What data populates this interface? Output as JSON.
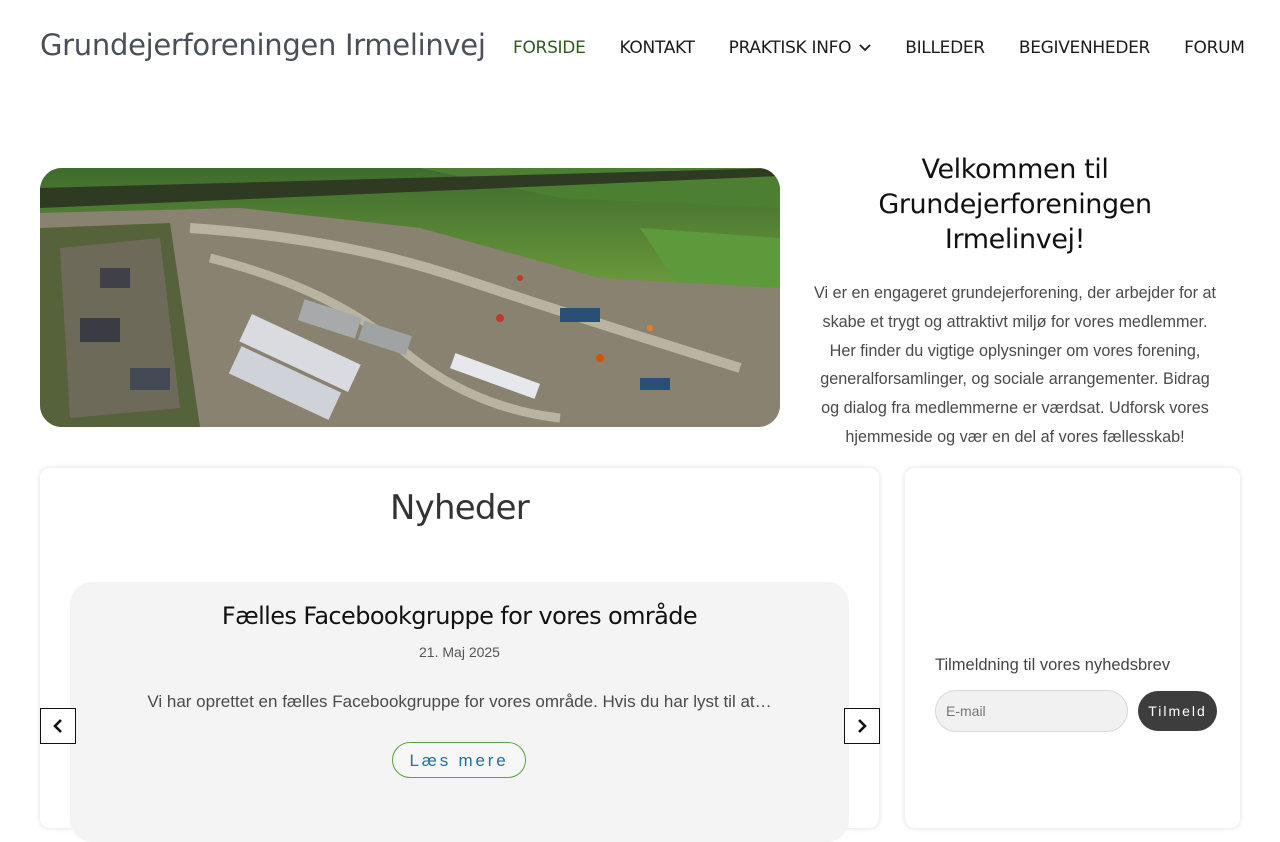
{
  "header": {
    "site_title": "Grundejerforeningen Irmelinvej",
    "nav": [
      {
        "label": "FORSIDE",
        "active": true
      },
      {
        "label": "KONTAKT"
      },
      {
        "label": "PRAKTISK INFO",
        "has_dropdown": true
      },
      {
        "label": "BILLEDER"
      },
      {
        "label": "BEGIVENHEDER"
      },
      {
        "label": "FORUM"
      }
    ]
  },
  "hero": {
    "welcome_title": "Velkommen til Grundejerforeningen Irmelinvej!",
    "welcome_text": "Vi er en engageret grundejerforening, der arbejder for at skabe et trygt og attraktivt miljø for vores medlemmer. Her finder du vigtige oplysninger om vores forening, generalforsamlinger, og sociale arrangementer. Bidrag og dialog fra medlemmerne er værdsat. Udforsk vores hjemmeside og vær en del af vores fællesskab!"
  },
  "news": {
    "title": "Nyheder",
    "slide": {
      "title": "Fælles Facebookgruppe for vores område",
      "date": "21. Maj 2025",
      "excerpt": "Vi har oprettet en fælles Facebookgruppe for vores område. Hvis du har lyst til at…",
      "read_more": "Læs mere"
    }
  },
  "newsletter": {
    "label": "Tilmeldning til vores nyhedsbrev",
    "email_placeholder": "E-mail",
    "email_value": "",
    "submit_label": "Tilmeld"
  },
  "colors": {
    "active_nav": "#2d5a1f",
    "button_dark": "#3d3d3d",
    "read_more_border": "#5aa342",
    "read_more_text": "#1f6fa8"
  }
}
